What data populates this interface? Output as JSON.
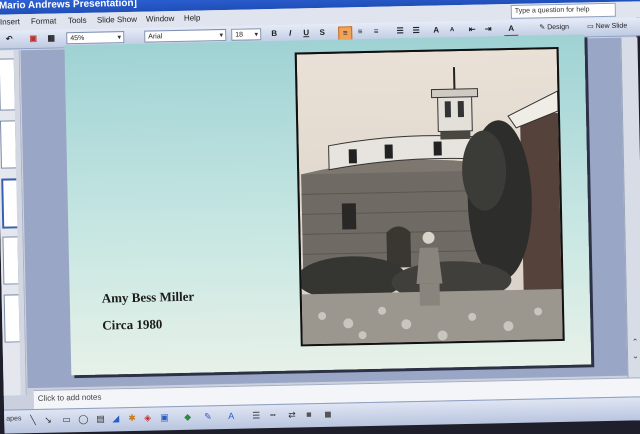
{
  "window": {
    "title": "[Mario Andrews Presentation]"
  },
  "menu": {
    "items": [
      "Insert",
      "Format",
      "Tools",
      "Slide Show",
      "Window",
      "Help"
    ]
  },
  "help_box": {
    "placeholder": "Type a question for help"
  },
  "toolbar": {
    "zoom": "45%",
    "font": "Arial",
    "font_size": "18",
    "bold": "B",
    "italic": "I",
    "underline": "U",
    "shadow": "S",
    "grow_font": "A",
    "shrink_font": "A",
    "font_color": "A",
    "design": "Design",
    "new_slide": "New Slide"
  },
  "slide": {
    "caption_name": "Amy Bess Miller",
    "caption_date": "Circa 1980"
  },
  "notes": {
    "placeholder": "Click to add notes"
  },
  "drawbar": {
    "autoshapes": "apes"
  }
}
